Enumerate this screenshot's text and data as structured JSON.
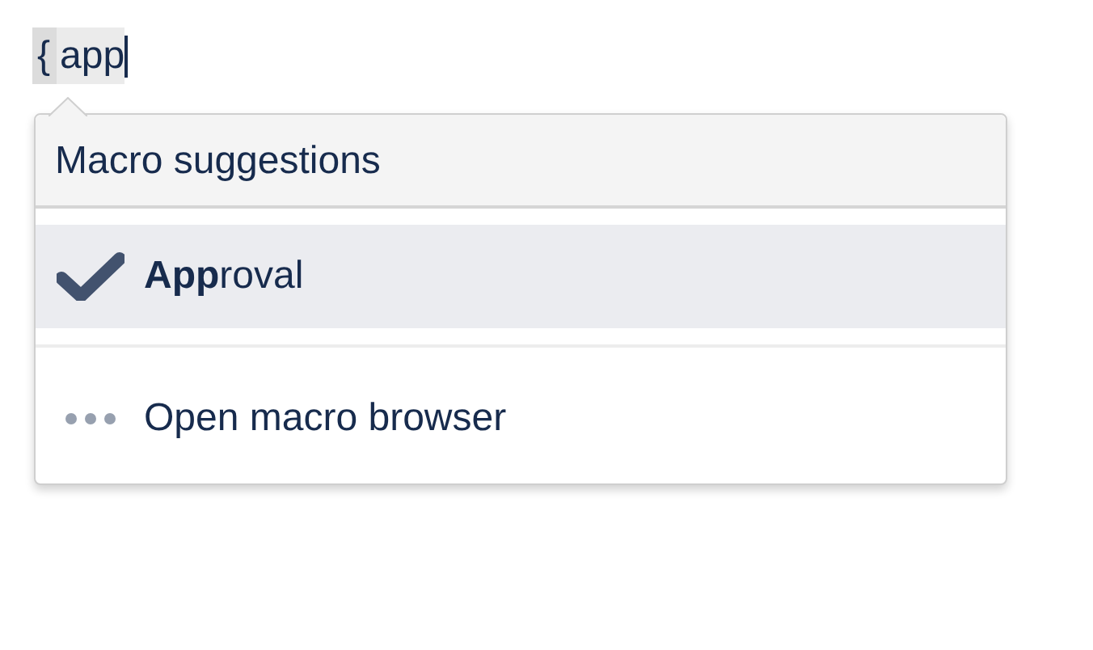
{
  "editor": {
    "brace": "{",
    "query": "app"
  },
  "dropdown": {
    "heading": "Macro suggestions",
    "items": [
      {
        "kind": "macro",
        "label": "**App**roval",
        "selected": true
      },
      {
        "kind": "browse",
        "label": "Open macro browser",
        "selected": false
      }
    ]
  }
}
